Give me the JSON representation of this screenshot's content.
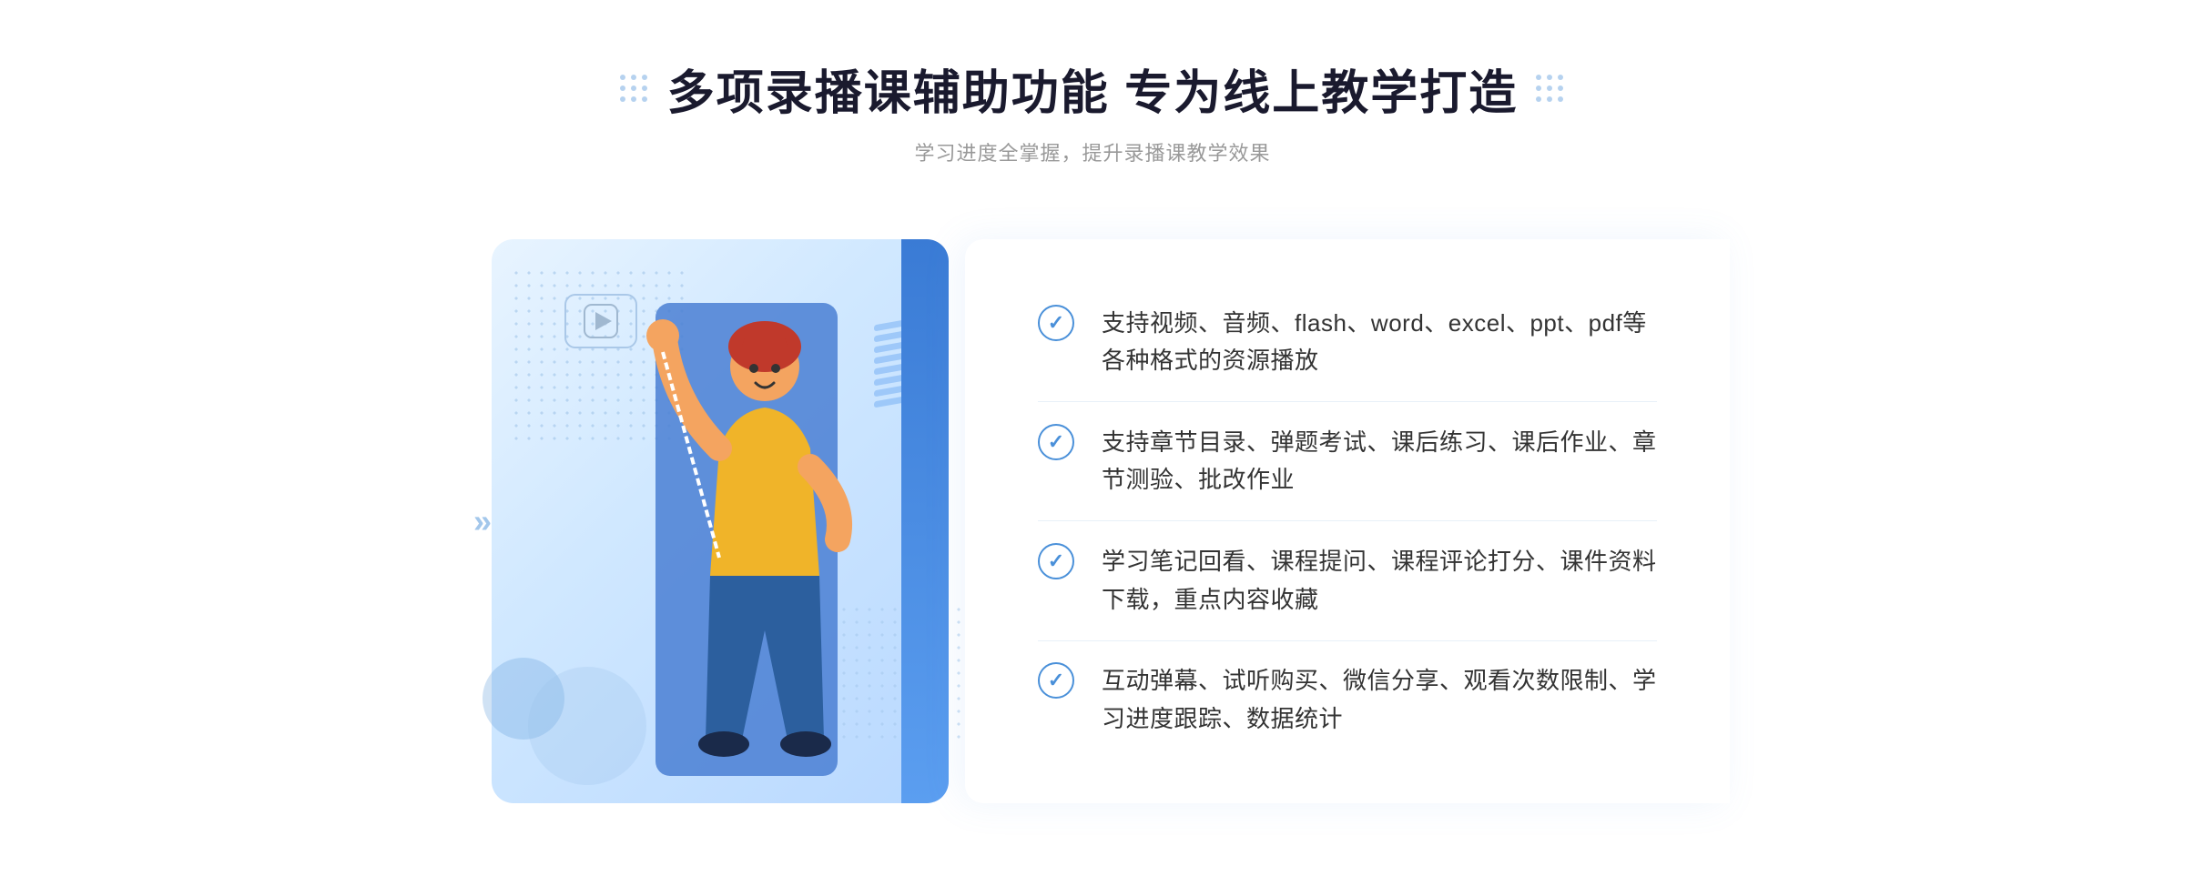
{
  "header": {
    "title": "多项录播课辅助功能 专为线上教学打造",
    "subtitle": "学习进度全掌握，提升录播课教学效果"
  },
  "features": [
    {
      "id": "feature-1",
      "text": "支持视频、音频、flash、word、excel、ppt、pdf等各种格式的资源播放"
    },
    {
      "id": "feature-2",
      "text": "支持章节目录、弹题考试、课后练习、课后作业、章节测验、批改作业"
    },
    {
      "id": "feature-3",
      "text": "学习笔记回看、课程提问、课程评论打分、课件资料下载，重点内容收藏"
    },
    {
      "id": "feature-4",
      "text": "互动弹幕、试听购买、微信分享、观看次数限制、学习进度跟踪、数据统计"
    }
  ],
  "icons": {
    "check": "✓",
    "chevron": "»",
    "play": "▶"
  },
  "colors": {
    "primary": "#4a90d9",
    "title": "#1a1a2e",
    "subtitle": "#999999",
    "text": "#333333",
    "light_blue": "#e8f4ff",
    "medium_blue": "#5b9ef0"
  }
}
